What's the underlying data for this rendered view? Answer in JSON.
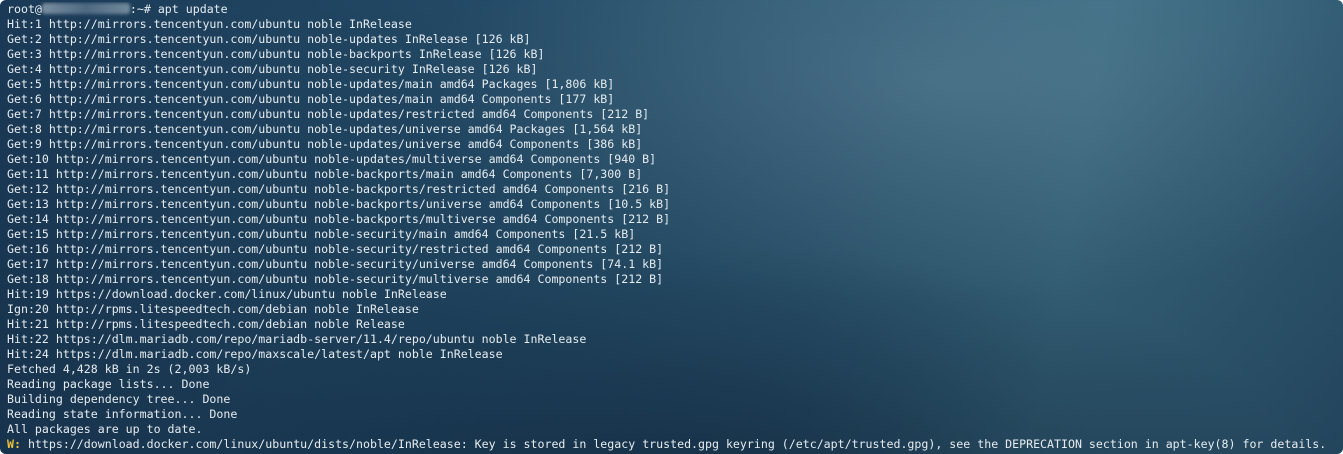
{
  "terminal": {
    "prompt": {
      "user": "root@",
      "suffix": ":~# ",
      "command": "apt update"
    },
    "lines": [
      "Hit:1 http://mirrors.tencentyun.com/ubuntu noble InRelease",
      "Get:2 http://mirrors.tencentyun.com/ubuntu noble-updates InRelease [126 kB]",
      "Get:3 http://mirrors.tencentyun.com/ubuntu noble-backports InRelease [126 kB]",
      "Get:4 http://mirrors.tencentyun.com/ubuntu noble-security InRelease [126 kB]",
      "Get:5 http://mirrors.tencentyun.com/ubuntu noble-updates/main amd64 Packages [1,806 kB]",
      "Get:6 http://mirrors.tencentyun.com/ubuntu noble-updates/main amd64 Components [177 kB]",
      "Get:7 http://mirrors.tencentyun.com/ubuntu noble-updates/restricted amd64 Components [212 B]",
      "Get:8 http://mirrors.tencentyun.com/ubuntu noble-updates/universe amd64 Packages [1,564 kB]",
      "Get:9 http://mirrors.tencentyun.com/ubuntu noble-updates/universe amd64 Components [386 kB]",
      "Get:10 http://mirrors.tencentyun.com/ubuntu noble-updates/multiverse amd64 Components [940 B]",
      "Get:11 http://mirrors.tencentyun.com/ubuntu noble-backports/main amd64 Components [7,300 B]",
      "Get:12 http://mirrors.tencentyun.com/ubuntu noble-backports/restricted amd64 Components [216 B]",
      "Get:13 http://mirrors.tencentyun.com/ubuntu noble-backports/universe amd64 Components [10.5 kB]",
      "Get:14 http://mirrors.tencentyun.com/ubuntu noble-backports/multiverse amd64 Components [212 B]",
      "Get:15 http://mirrors.tencentyun.com/ubuntu noble-security/main amd64 Components [21.5 kB]",
      "Get:16 http://mirrors.tencentyun.com/ubuntu noble-security/restricted amd64 Components [212 B]",
      "Get:17 http://mirrors.tencentyun.com/ubuntu noble-security/universe amd64 Components [74.1 kB]",
      "Get:18 http://mirrors.tencentyun.com/ubuntu noble-security/multiverse amd64 Components [212 B]",
      "Hit:19 https://download.docker.com/linux/ubuntu noble InRelease",
      "Ign:20 http://rpms.litespeedtech.com/debian noble InRelease",
      "Hit:21 http://rpms.litespeedtech.com/debian noble Release",
      "Hit:22 https://dlm.mariadb.com/repo/mariadb-server/11.4/repo/ubuntu noble InRelease",
      "Hit:24 https://dlm.mariadb.com/repo/maxscale/latest/apt noble InRelease",
      "Fetched 4,428 kB in 2s (2,003 kB/s)",
      "Reading package lists... Done",
      "Building dependency tree... Done",
      "Reading state information... Done",
      "All packages are up to date."
    ],
    "warning": {
      "prefix": "W:",
      "text": " https://download.docker.com/linux/ubuntu/dists/noble/InRelease: Key is stored in legacy trusted.gpg keyring (/etc/apt/trusted.gpg), see the DEPRECATION section in apt-key(8) for details."
    },
    "colors": {
      "text": "#e6ecef",
      "warning_prefix": "#e8c23a",
      "background_dark": "#1b3a57",
      "background_light": "#3a6a80"
    }
  }
}
